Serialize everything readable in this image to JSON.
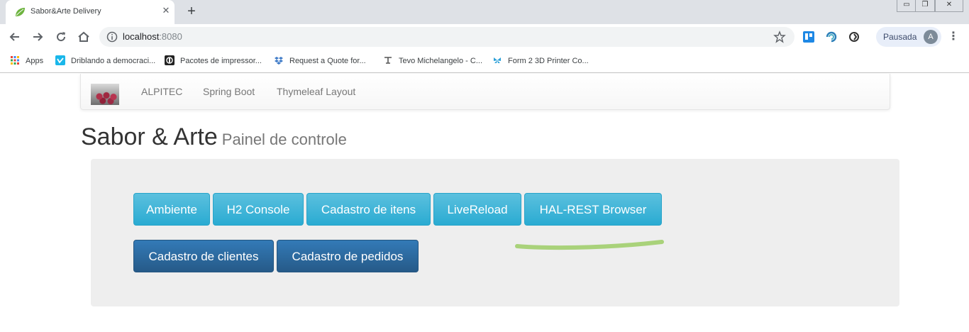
{
  "browser": {
    "tab_title": "Sabor&Arte Delivery",
    "address": {
      "host": "localhost",
      "port": ":8080"
    },
    "profile_label": "Pausada",
    "profile_initial": "A",
    "bookmarks": [
      {
        "label": "Apps",
        "icon": "apps-grid-icon"
      },
      {
        "label": "Driblando a democraci...",
        "icon": "vimeo-icon"
      },
      {
        "label": "Pacotes de impressor...",
        "icon": "printer-site-icon"
      },
      {
        "label": "Request a Quote for...",
        "icon": "dropbox-icon"
      },
      {
        "label": "Tevo Michelangelo - C...",
        "icon": "tevo-icon"
      },
      {
        "label": "Form 2 3D Printer Co...",
        "icon": "butterfly-icon"
      }
    ]
  },
  "navbar": {
    "links": [
      "ALPITEC",
      "Spring Boot",
      "Thymeleaf Layout"
    ]
  },
  "header": {
    "title": "Sabor & Arte",
    "subtitle": "Painel de controle"
  },
  "buttons_row1": [
    "Ambiente",
    "H2 Console",
    "Cadastro de itens",
    "LiveReload",
    "HAL-REST Browser"
  ],
  "buttons_row2": [
    "Cadastro de clientes",
    "Cadastro de pedidos"
  ],
  "colors": {
    "info": "#31b0d5",
    "primary": "#286090",
    "highlight_stroke": "#9ccc65"
  }
}
